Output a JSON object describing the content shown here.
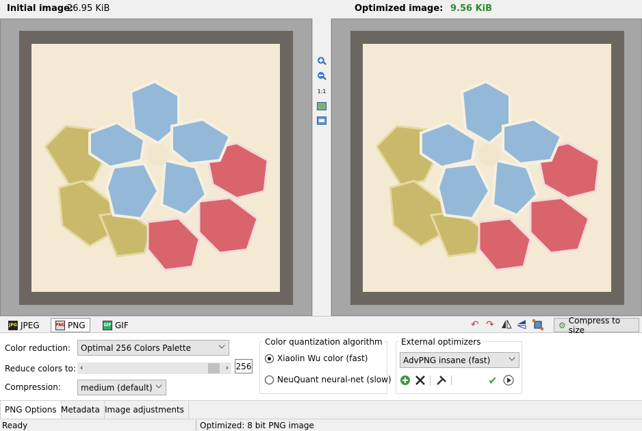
{
  "info": {
    "initial_label": "Initial image:",
    "initial_value": "26.95 KiB",
    "optimized_label": "Optimized image:",
    "optimized_value": "9.56 KiB",
    "optimized_color": "#2e8b2e"
  },
  "preview": {
    "frame_color": "#6b6760",
    "canvas_color": "#f4ead4",
    "petal_colors": {
      "blue": "#94b9d8",
      "red": "#d9646b",
      "olive": "#c9b96a"
    }
  },
  "midbar": {
    "zoom_in_icon": "zoom-in-icon",
    "zoom_out_icon": "zoom-out-icon",
    "actual_size_label": "1:1",
    "fit_icon": "fit-window-icon",
    "compare_icon": "compare-icon"
  },
  "format_tabs": [
    {
      "label": "JPEG",
      "icon": "jpeg-icon"
    },
    {
      "label": "PNG",
      "icon": "png-icon",
      "active": true
    },
    {
      "label": "GIF",
      "icon": "gif-icon"
    }
  ],
  "right_tools": {
    "icons": [
      "rotate-left-icon",
      "rotate-right-icon",
      "flip-horizontal-icon",
      "flip-vertical-icon",
      "crop-icon"
    ],
    "compress_label": "Compress to size"
  },
  "png_options": {
    "color_reduction_label": "Color reduction:",
    "color_reduction_value": "Optimal 256 Colors Palette",
    "reduce_colors_label": "Reduce colors to:",
    "reduce_colors_value": "256",
    "compression_label": "Compression:",
    "compression_value": "medium (default)"
  },
  "quantization": {
    "title": "Color quantization algorithm",
    "options": [
      {
        "label": "Xiaolin Wu color (fast)",
        "selected": true
      },
      {
        "label": "NeuQuant neural-net (slow)",
        "selected": false
      }
    ]
  },
  "external": {
    "title": "External optimizers",
    "value": "AdvPNG insane (fast)",
    "icons": [
      "add-icon",
      "remove-icon",
      "settings-icon",
      "apply-icon",
      "run-icon"
    ]
  },
  "bottom_tabs": [
    {
      "label": "PNG Options",
      "active": true
    },
    {
      "label": "Metadata"
    },
    {
      "label": "Image adjustments"
    }
  ],
  "status": {
    "left": "Ready",
    "right": "Optimized: 8 bit PNG image"
  }
}
